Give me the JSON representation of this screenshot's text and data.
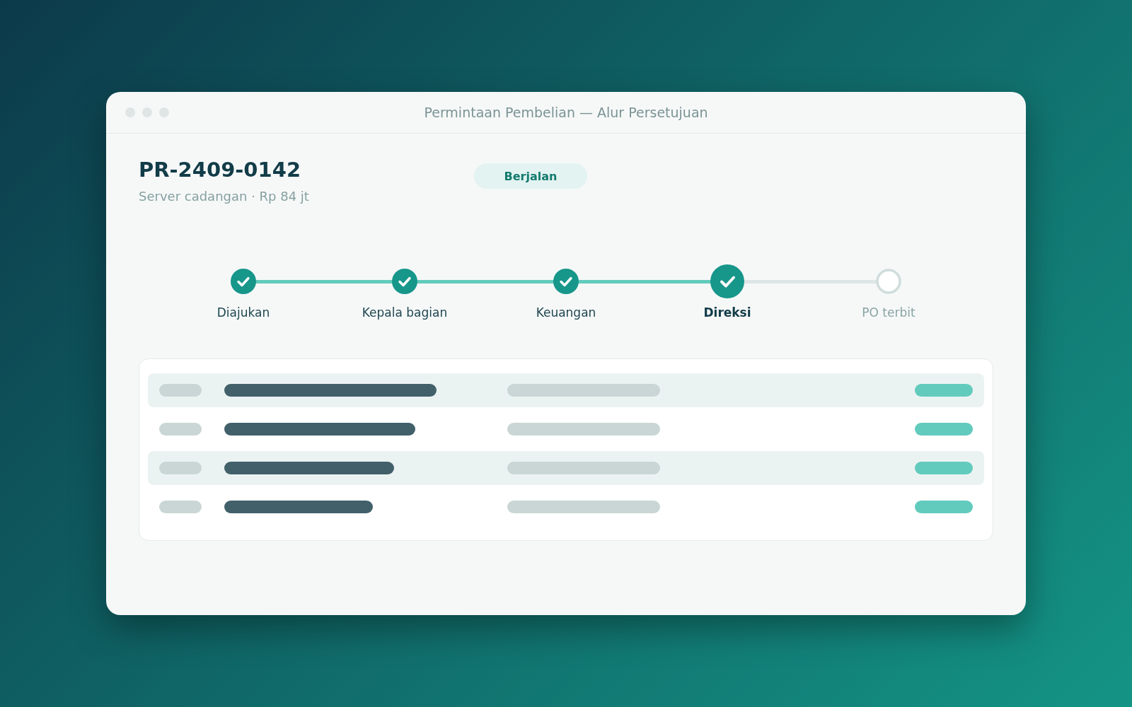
{
  "window": {
    "title": "Permintaan Pembelian — Alur Persetujuan"
  },
  "request": {
    "id": "PR-2409-0142",
    "subtitle": "Server cadangan · Rp 84 jt",
    "status": "Berjalan"
  },
  "steps": [
    {
      "label": "Diajukan",
      "kind": "done"
    },
    {
      "label": "Kepala bagian",
      "kind": "done"
    },
    {
      "label": "Keuangan",
      "kind": "done"
    },
    {
      "label": "Direksi",
      "kind": "current"
    },
    {
      "label": "PO terbit",
      "kind": "pending"
    }
  ],
  "table": {
    "rows": [
      {
        "selected": true
      },
      {
        "selected": false
      },
      {
        "selected": true
      },
      {
        "selected": false
      }
    ]
  }
}
